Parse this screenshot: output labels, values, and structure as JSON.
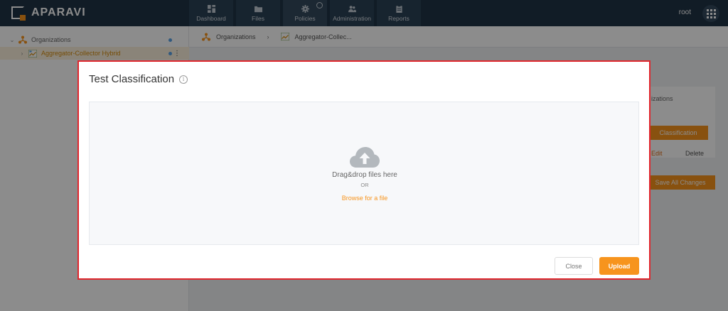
{
  "app": {
    "brand": "APARAVI"
  },
  "nav": {
    "items": [
      {
        "label": "Dashboard",
        "icon": "dashboard-icon"
      },
      {
        "label": "Files",
        "icon": "folder-icon"
      },
      {
        "label": "Policies",
        "icon": "gear-icon"
      },
      {
        "label": "Administration",
        "icon": "users-icon"
      },
      {
        "label": "Reports",
        "icon": "clipboard-icon"
      }
    ],
    "active": "Policies",
    "user": "root"
  },
  "tree": {
    "items": [
      {
        "label": "Organizations",
        "expanded": true
      },
      {
        "label": "Aggregator-Collector Hybrid",
        "selected": true
      }
    ]
  },
  "breadcrumb": {
    "items": [
      "Organizations",
      "Aggregator-Collec..."
    ]
  },
  "background": {
    "panel_text": "izations",
    "classification_button": "Classification",
    "edit_label": "Edit",
    "delete_label": "Delete",
    "save_all_label": "Save All Changes"
  },
  "modal": {
    "title": "Test Classification",
    "dropzone_text": "Drag&drop files here",
    "or_text": "OR",
    "browse_label": "Browse for a file",
    "close_label": "Close",
    "upload_label": "Upload"
  },
  "colors": {
    "accent": "#f7941d",
    "topbar": "#1f3346",
    "modal_border": "#e0262d"
  }
}
